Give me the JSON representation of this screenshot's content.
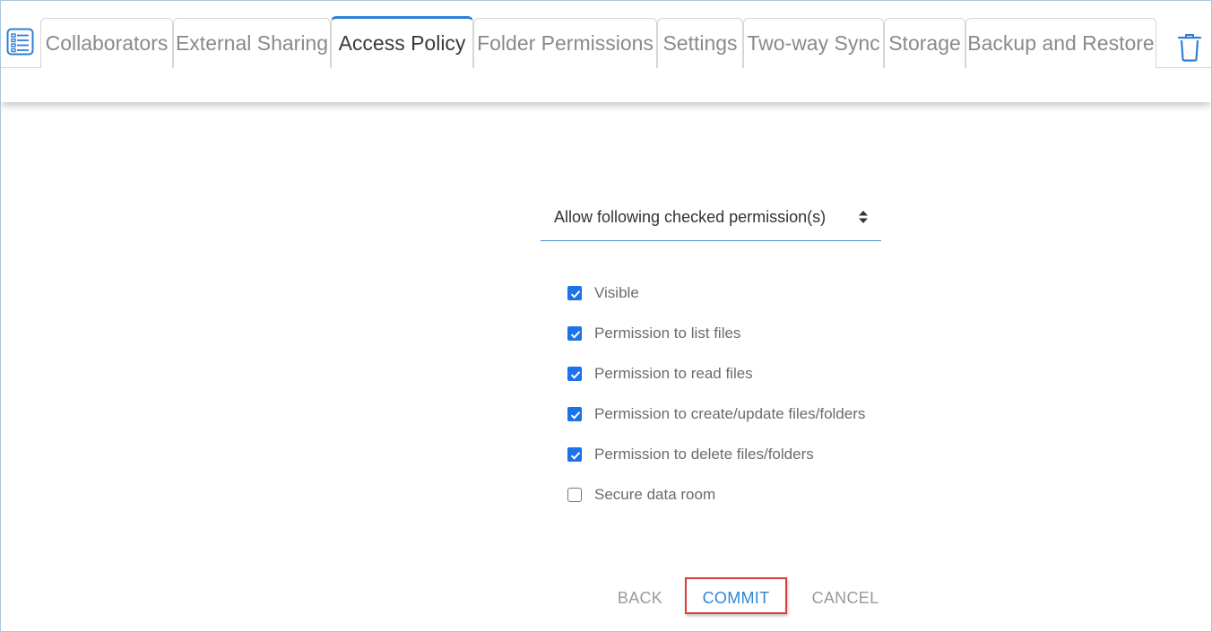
{
  "icons": {
    "menu": "list-menu-icon",
    "delete": "trash-icon",
    "select_arrow": "sort-arrows-icon",
    "checkmark": "checkmark-icon"
  },
  "colors": {
    "accent": "#2f7fd6",
    "checkbox": "#1a73e8",
    "commit_text": "#2f86d6",
    "highlight": "#e03b3b"
  },
  "tabs": [
    {
      "label": "Collaborators",
      "active": false
    },
    {
      "label": "External Sharing",
      "active": false
    },
    {
      "label": "Access Policy",
      "active": true
    },
    {
      "label": "Folder Permissions",
      "active": false
    },
    {
      "label": "Settings",
      "active": false
    },
    {
      "label": "Two-way Sync",
      "active": false
    },
    {
      "label": "Storage",
      "active": false
    },
    {
      "label": "Backup and Restore",
      "active": false
    }
  ],
  "policy_select": {
    "value": "Allow following checked permission(s)"
  },
  "permissions": [
    {
      "label": "Visible",
      "checked": true
    },
    {
      "label": "Permission to list files",
      "checked": true
    },
    {
      "label": "Permission to read files",
      "checked": true
    },
    {
      "label": "Permission to create/update files/folders",
      "checked": true
    },
    {
      "label": "Permission to delete files/folders",
      "checked": true
    },
    {
      "label": "Secure data room",
      "checked": false
    }
  ],
  "actions": {
    "back": "BACK",
    "commit": "COMMIT",
    "cancel": "CANCEL"
  }
}
